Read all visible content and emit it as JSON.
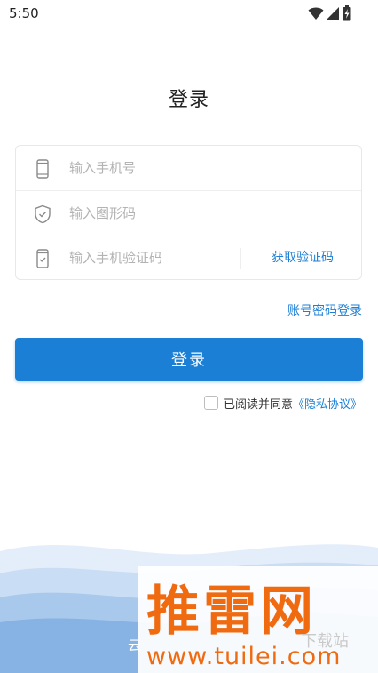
{
  "status_bar": {
    "time": "5:50"
  },
  "page": {
    "title": "登录"
  },
  "form": {
    "phone_placeholder": "输入手机号",
    "captcha_placeholder": "输入图形码",
    "sms_code_placeholder": "输入手机验证码",
    "get_code_label": "获取验证码"
  },
  "account_login_label": "账号密码登录",
  "login_button_label": "登录",
  "agreement": {
    "text": "已阅读并同意",
    "link_label": "《隐私协议》",
    "checked": false
  },
  "footer": {
    "text": "云"
  },
  "watermark": {
    "logo_text": "推雷网",
    "sub_text": "下载站",
    "url": "www.tuilei.com"
  },
  "colors": {
    "accent": "#1b80d5",
    "link": "#1b7fd6",
    "watermark": "#f06a10"
  },
  "icons": {
    "phone_row": "phone-icon",
    "captcha_row": "shield-check-icon",
    "sms_row": "phone-check-icon"
  }
}
